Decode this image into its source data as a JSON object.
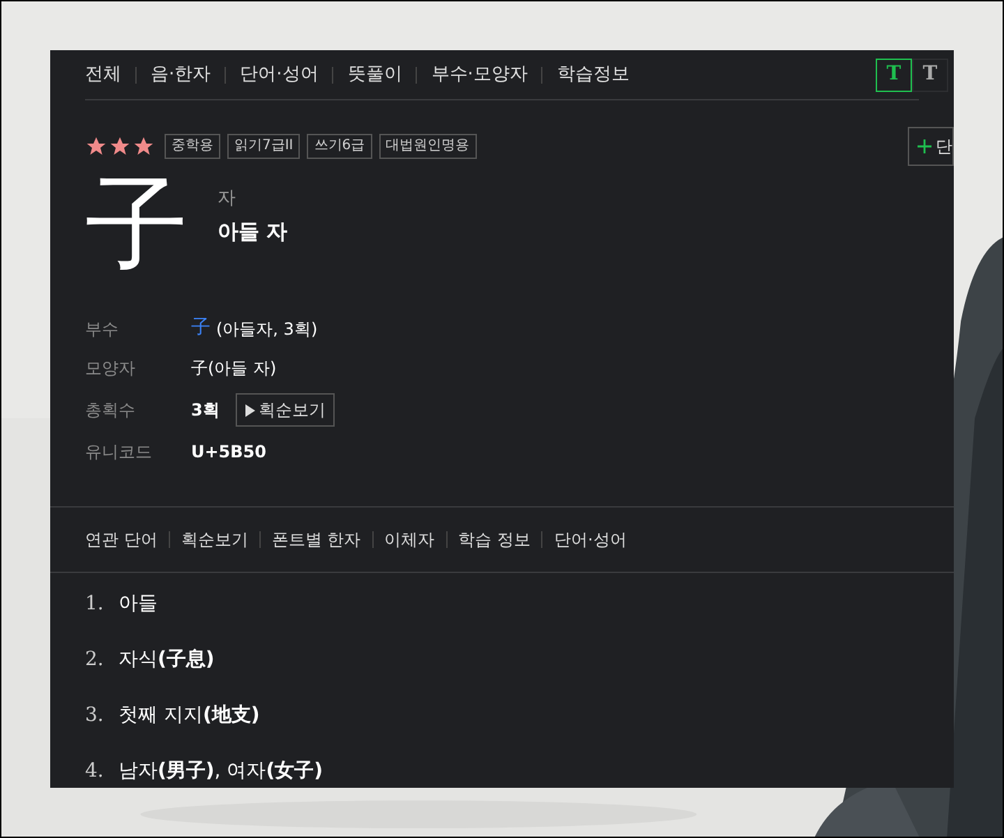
{
  "nav": [
    {
      "label": "전체"
    },
    {
      "label": "음·한자"
    },
    {
      "label": "단어·성어"
    },
    {
      "label": "뜻풀이"
    },
    {
      "label": "부수·모양자"
    },
    {
      "label": "학습정보"
    }
  ],
  "font_buttons": [
    {
      "label": "T",
      "selected": true
    },
    {
      "label": "T",
      "selected": false
    }
  ],
  "stars": 3,
  "tags": [
    "중학용",
    "읽기7급II",
    "쓰기6급",
    "대법원인명용"
  ],
  "add_button": {
    "label": "단"
  },
  "character": {
    "glyph": "子",
    "reading": "자",
    "meaning": "아들 자"
  },
  "info": [
    {
      "kind": "link",
      "label": "부수",
      "link": "子",
      "value": "(아들자, 3획)"
    },
    {
      "kind": "text",
      "label": "모양자",
      "value": "子(아들 자)"
    },
    {
      "kind": "strokes",
      "label": "총획수",
      "value": "3획",
      "button": "획순보기"
    },
    {
      "kind": "text",
      "label": "유니코드",
      "value": "U+5B50"
    }
  ],
  "sub_nav": [
    "연관 단어",
    "획순보기",
    "폰트별 한자",
    "이체자",
    "학습 정보",
    "단어·성어"
  ],
  "meanings": [
    {
      "number": "1.",
      "text": "아들"
    },
    {
      "number": "2.",
      "text": "자식**(子息)**"
    },
    {
      "number": "3.",
      "text": "첫째 지지**(地支)**"
    },
    {
      "number": "4.",
      "text": "남자**(男子)**, 여자**(女子)**"
    }
  ]
}
